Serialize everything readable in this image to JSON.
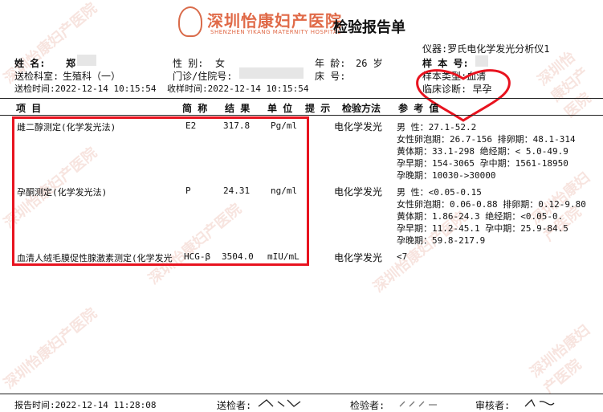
{
  "header": {
    "hospital_name": "深圳怡康妇产医院",
    "hospital_en": "SHENZHEN YIKANG MATERNITY HOSPITAL",
    "title": "检验报告单"
  },
  "patient": {
    "name_label": "姓    名:",
    "name_value": "郑",
    "gender_label": "性  别:",
    "gender_value": "女",
    "age_label": "年  龄:",
    "age_value": "26 岁",
    "dept_label": "送检科室:",
    "dept_value": "生殖科（一）",
    "clinic_label": "门诊/住院号:",
    "bed_label": "床  号:",
    "sent_time_label": "送检时间:",
    "sent_time_value": "2022-12-14 10:15:54",
    "recv_time_label": "收样时间:",
    "recv_time_value": "2022-12-14 10:15:54"
  },
  "right_info": {
    "instrument_label": "仪器:",
    "instrument_value": "罗氏电化学发光分析仪1",
    "sample_no_label": "样 本 号:",
    "sample_type_label": "样本类型:",
    "sample_type_value": "血清",
    "diagnosis_label": "临床诊断:",
    "diagnosis_value": "早孕"
  },
  "columns": {
    "item": "项    目",
    "abbr": "简 称",
    "result": "结 果",
    "unit": "单 位",
    "hint": "提 示",
    "method": "检验方法",
    "ref": "参 考 值"
  },
  "rows": [
    {
      "item": "雌二醇测定(化学发光法)",
      "abbr": "E2",
      "result": "317.8",
      "unit": "Pg/ml",
      "method": "电化学发光",
      "refs": [
        "男    性：27.1-52.2",
        "女性卵泡期：26.7-156 排卵期：48.1-314",
        "黄体期：33.1-298   绝经期：< 5.0-49.9",
        "孕早期：154-3065   孕中期：1561-18950",
        "孕晚期：10030->30000"
      ]
    },
    {
      "item": "孕酮测定(化学发光法)",
      "abbr": "P",
      "result": "24.31",
      "unit": "ng/ml",
      "method": "电化学发光",
      "refs": [
        "男    性：<0.05-0.15",
        "女性卵泡期：0.06-0.88 排卵期：0.12-9.80",
        "黄体期：1.86-24.3      绝经期：<0.05-0.",
        "孕早期：11.2-45.1    孕中期：25.9-84.5",
        "孕晚期：59.8-217.9"
      ]
    },
    {
      "item": "血清人绒毛膜促性腺激素测定(化学发光",
      "abbr": "HCG-β",
      "result": "3504.0",
      "unit": "mIU/mL",
      "method": "电化学发光",
      "refs": [
        "<7"
      ]
    }
  ],
  "footer": {
    "report_time_label": "报告时间:",
    "report_time_value": "2022-12-14 11:28:08",
    "sender_label": "送检者:",
    "tester_label": "检验者:",
    "reviewer_label": "审核者:"
  },
  "colors": {
    "brand": "#e06a48",
    "annotation_red": "#e8131f",
    "watermark": "#f3d3cb"
  }
}
